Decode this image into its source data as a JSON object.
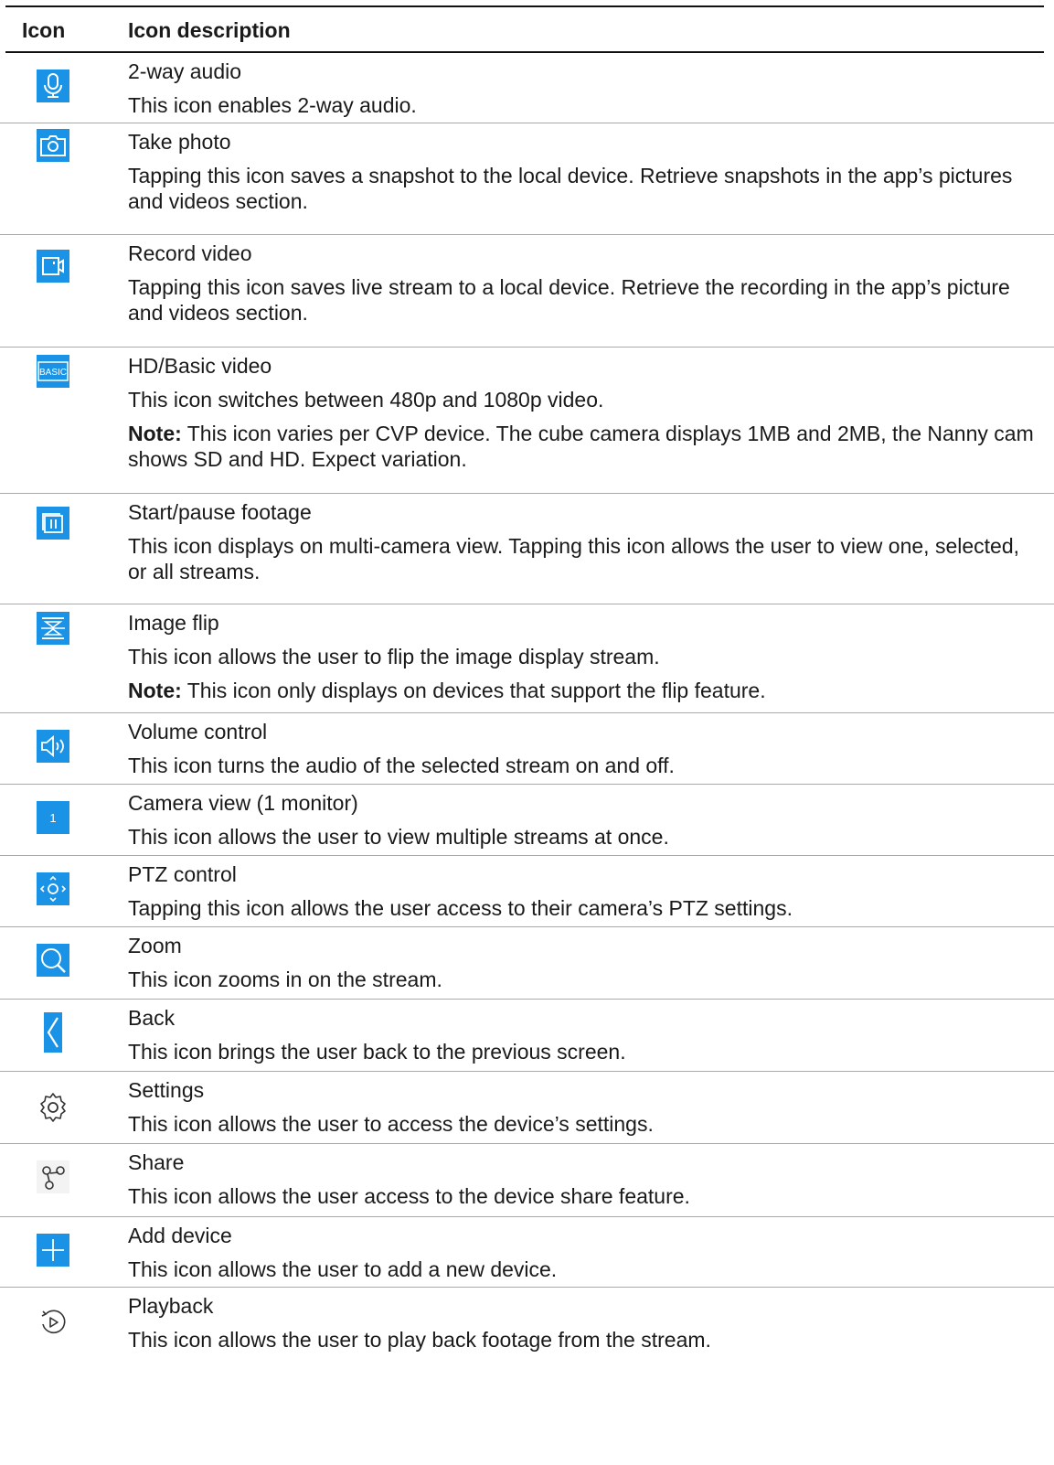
{
  "table": {
    "header": {
      "icon": "Icon",
      "description": "Icon description"
    },
    "rows": [
      {
        "icon": "microphone-icon",
        "title": "2-way audio",
        "desc": "This icon enables 2-way audio."
      },
      {
        "icon": "camera-icon",
        "title": "Take photo",
        "desc": "Tapping this icon saves a snapshot to the local device. Retrieve snapshots in the app’s pictures and videos section."
      },
      {
        "icon": "video-record-icon",
        "title": "Record video",
        "desc": "Tapping this icon saves live stream to a local device. Retrieve the recording in the app’s picture and videos section."
      },
      {
        "icon": "basic-quality-icon",
        "icon_text": "BASIC",
        "title": "HD/Basic video",
        "desc": "This icon switches between 480p and 1080p video.",
        "note_label": "Note:",
        "note_text": " This icon varies per CVP device. The cube camera displays 1MB and 2MB, the Nanny cam shows SD and HD. Expect variation."
      },
      {
        "icon": "pause-footage-icon",
        "title": "Start/pause footage",
        "desc": "This icon displays on multi-camera view. Tapping this icon allows the user to view one, selected, or all streams."
      },
      {
        "icon": "image-flip-icon",
        "title": "Image flip",
        "desc": "This icon allows the user to flip the image display stream.",
        "note_label": "Note:",
        "note_text": " This icon only displays on devices that support the flip feature."
      },
      {
        "icon": "volume-icon",
        "title": "Volume control",
        "desc": "This icon turns the audio of the selected stream on and off."
      },
      {
        "icon": "single-view-icon",
        "icon_text": "1",
        "title": "Camera view (1 monitor)",
        "desc": "This icon allows the user to view multiple streams at once."
      },
      {
        "icon": "ptz-control-icon",
        "title": "PTZ control",
        "desc": "Tapping this icon allows the user access to their camera’s PTZ settings."
      },
      {
        "icon": "zoom-icon",
        "title": "Zoom",
        "desc": "This icon zooms in on the stream."
      },
      {
        "icon": "back-arrow-icon",
        "title": "Back",
        "desc": "This icon brings the user back to the previous screen."
      },
      {
        "icon": "gear-icon",
        "title": "Settings",
        "desc": "This icon allows the user to access the device’s settings."
      },
      {
        "icon": "share-icon",
        "title": "Share",
        "desc": "This icon allows the user access to the device share feature."
      },
      {
        "icon": "add-device-icon",
        "title": "Add device",
        "desc": "This icon allows the user to add a new device."
      },
      {
        "icon": "playback-icon",
        "title": "Playback",
        "desc": "This icon allows the user to play back footage from the stream."
      }
    ]
  },
  "colors": {
    "icon_blue": "#1a93e6",
    "rule": "#a9a9a9",
    "header_rule": "#111111"
  }
}
